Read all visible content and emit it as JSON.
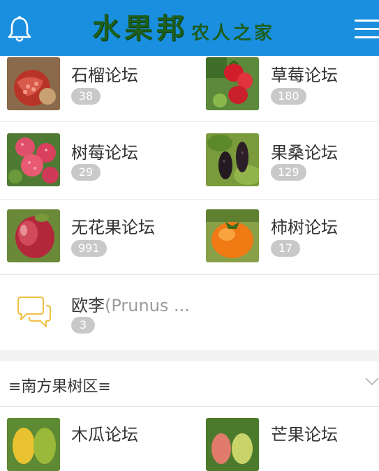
{
  "header": {
    "brand_main": "水果邦",
    "brand_sub": "农人之家",
    "icons": {
      "left": "bell-icon",
      "right": "menu-icon"
    },
    "colors": {
      "bar": "#1a8fe0",
      "brand_text": "#1d5e1d"
    }
  },
  "forums": [
    {
      "title": "石榴论坛",
      "count": "38",
      "icon": "pomegranate"
    },
    {
      "title": "草莓论坛",
      "count": "180",
      "icon": "strawberry"
    },
    {
      "title": "树莓论坛",
      "count": "29",
      "icon": "raspberry"
    },
    {
      "title": "果桑论坛",
      "count": "129",
      "icon": "mulberry"
    },
    {
      "title": "无花果论坛",
      "count": "991",
      "icon": "fig"
    },
    {
      "title": "柿树论坛",
      "count": "17",
      "icon": "persimmon"
    },
    {
      "title": "欧李",
      "title_latin": "(Prunus ...",
      "count": "3",
      "icon": "chat-bubbles"
    }
  ],
  "section": {
    "title": "≡南方果树区≡",
    "items": [
      {
        "title": "木瓜论坛",
        "icon": "papaya"
      },
      {
        "title": "芒果论坛",
        "icon": "mango"
      }
    ]
  }
}
